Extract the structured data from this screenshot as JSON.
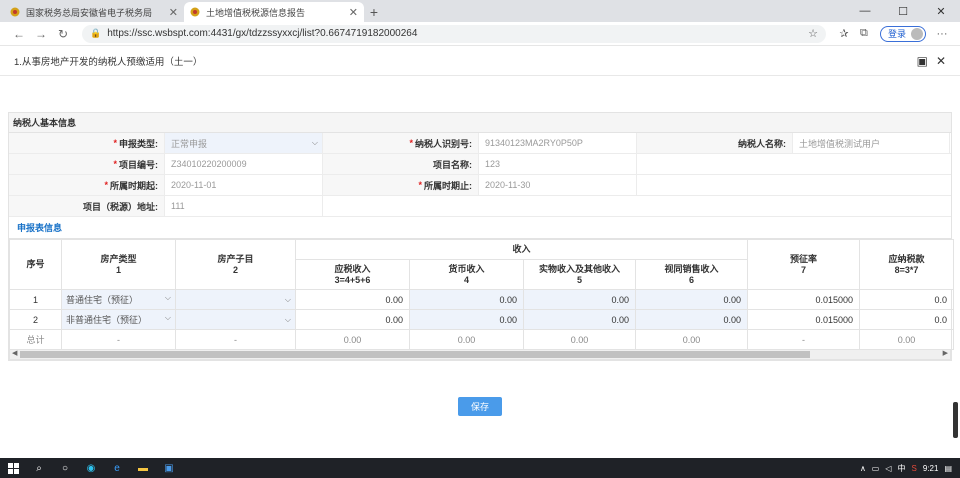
{
  "browser": {
    "tabs": [
      {
        "title": "国家税务总局安徽省电子税务局",
        "active": false
      },
      {
        "title": "土地增值税税源信息报告",
        "active": true
      }
    ],
    "url": "https://ssc.wsbspt.com:4431/gx/tdzzssyxxcj/list?0.6674719182000264",
    "login_label": "登录",
    "window_controls": [
      "—",
      "☐",
      "✕"
    ]
  },
  "modal": {
    "title": "1.从事房地产开发的纳税人预缴适用（土一）"
  },
  "basic_info": {
    "section_title": "纳税人基本信息",
    "rows": [
      [
        {
          "label": "申报类型:",
          "required": true,
          "value": "正常申报",
          "type": "select"
        },
        {
          "label": "纳税人识别号:",
          "required": true,
          "value": "91340123MA2RY0P50P",
          "type": "text"
        },
        {
          "label": "纳税人名称:",
          "required": false,
          "value": "土地增值税测试用户",
          "type": "text"
        }
      ],
      [
        {
          "label": "项目编号:",
          "required": true,
          "value": "Z34010220200009",
          "type": "text"
        },
        {
          "label": "项目名称:",
          "required": false,
          "value": "123",
          "type": "text"
        }
      ],
      [
        {
          "label": "所属时期起:",
          "required": true,
          "value": "2020-11-01",
          "type": "text"
        },
        {
          "label": "所属时期止:",
          "required": true,
          "value": "2020-11-30",
          "type": "text"
        }
      ],
      [
        {
          "label": "项目（税源）地址:",
          "required": false,
          "value": "111",
          "type": "text"
        }
      ]
    ]
  },
  "declaration": {
    "section_title": "申报表信息",
    "headers": {
      "seq": "序号",
      "house_type": "房产类型",
      "house_type_no": "1",
      "house_sub": "房产子目",
      "house_sub_no": "2",
      "income": "收入",
      "income_cols": [
        {
          "name": "应税收入",
          "formula": "3=4+5+6"
        },
        {
          "name": "货币收入",
          "formula": "4"
        },
        {
          "name": "实物收入及其他收入",
          "formula": "5"
        },
        {
          "name": "视同销售收入",
          "formula": "6"
        }
      ],
      "rate": "预征率",
      "rate_no": "7",
      "tax": "应纳税款",
      "tax_no": "8=3*7"
    },
    "rows": [
      {
        "seq": "1",
        "house_type": "普通住宅（预征）",
        "house_sub": "",
        "taxable": "0.00",
        "cash": "0.00",
        "kind": "0.00",
        "deemed": "0.00",
        "rate": "0.015000",
        "tax": "0.0"
      },
      {
        "seq": "2",
        "house_type": "非普通住宅（预征）",
        "house_sub": "",
        "taxable": "0.00",
        "cash": "0.00",
        "kind": "0.00",
        "deemed": "0.00",
        "rate": "0.015000",
        "tax": "0.0"
      }
    ],
    "total": {
      "seq": "总计",
      "house_type": "-",
      "house_sub": "-",
      "taxable": "0.00",
      "cash": "0.00",
      "kind": "0.00",
      "deemed": "0.00",
      "rate": "-",
      "tax": "0.00"
    }
  },
  "save_label": "保存",
  "taskbar": {
    "time": "9:21"
  }
}
